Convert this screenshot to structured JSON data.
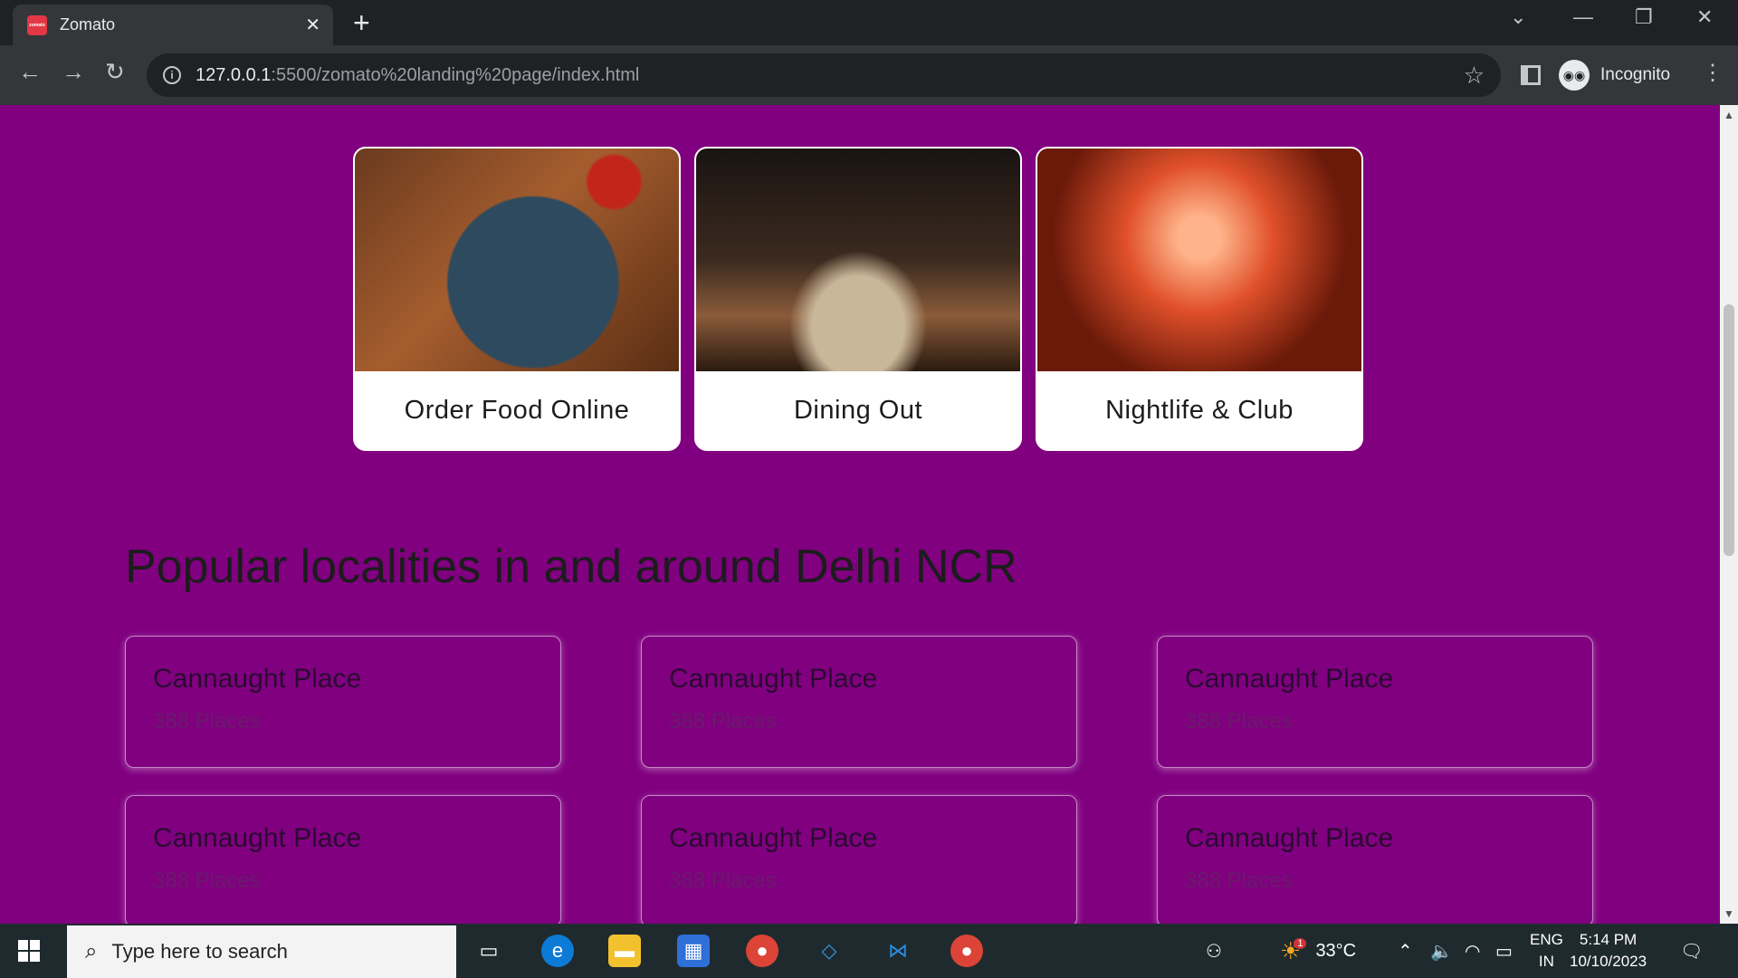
{
  "browser": {
    "tab_title": "Zomato",
    "tab_favicon_text": "zomato",
    "url_host": "127.0.0.1",
    "url_rest": ":5500/zomato%20landing%20page/index.html",
    "profile_label": "Incognito"
  },
  "page": {
    "cards": [
      {
        "label": "Order Food Online"
      },
      {
        "label": "Dining Out"
      },
      {
        "label": "Nightlife & Club"
      }
    ],
    "section_title": "Popular localities in and around Delhi NCR",
    "localities": [
      {
        "name": "Cannaught Place",
        "count": "388 Places"
      },
      {
        "name": "Cannaught Place",
        "count": "388 Places"
      },
      {
        "name": "Cannaught Place",
        "count": "388 Places"
      },
      {
        "name": "Cannaught Place",
        "count": "388 Places"
      },
      {
        "name": "Cannaught Place",
        "count": "388 Places"
      },
      {
        "name": "Cannaught Place",
        "count": "388 Places"
      }
    ],
    "bg_color": "#800080"
  },
  "taskbar": {
    "search_placeholder": "Type here to search",
    "weather": "33°C",
    "lang_top": "ENG",
    "lang_bottom": "IN",
    "time": "5:14 PM",
    "date": "10/10/2023",
    "weather_badge": "1"
  }
}
